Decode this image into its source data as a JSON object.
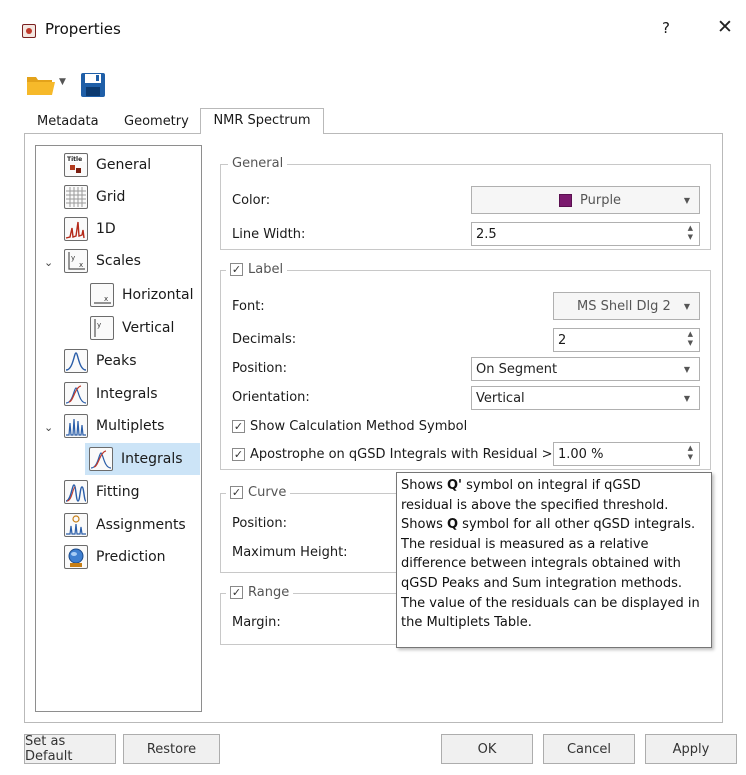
{
  "window": {
    "title": "Properties",
    "help_label": "?",
    "close_label": "✕"
  },
  "toolbar": {
    "open_icon": "folder-icon",
    "save_icon": "save-icon"
  },
  "tabs": [
    {
      "label": "Metadata"
    },
    {
      "label": "Geometry"
    },
    {
      "label": "NMR Spectrum",
      "active": true
    }
  ],
  "tree": {
    "items": [
      {
        "label": "General",
        "icon": "title-icon"
      },
      {
        "label": "Grid",
        "icon": "grid-icon"
      },
      {
        "label": "1D",
        "icon": "spectrum-1d-icon"
      },
      {
        "label": "Scales",
        "icon": "scales-icon",
        "expanded": true
      },
      {
        "label": "Horizontal",
        "icon": "horizontal-scale-icon"
      },
      {
        "label": "Vertical",
        "icon": "vertical-scale-icon"
      },
      {
        "label": "Peaks",
        "icon": "peaks-icon"
      },
      {
        "label": "Integrals",
        "icon": "integrals-icon"
      },
      {
        "label": "Multiplets",
        "icon": "multiplets-icon",
        "expanded": true
      },
      {
        "label": "Integrals",
        "icon": "integrals-icon",
        "selected": true
      },
      {
        "label": "Fitting",
        "icon": "fitting-icon"
      },
      {
        "label": "Assignments",
        "icon": "assignments-icon"
      },
      {
        "label": "Prediction",
        "icon": "prediction-icon"
      }
    ]
  },
  "general": {
    "title": "General",
    "color_label": "Color:",
    "color_value": "Purple",
    "color_swatch": "#7b1a6e",
    "line_width_label": "Line Width:",
    "line_width_value": "2.5"
  },
  "label": {
    "title": "Label",
    "checked": true,
    "font_label": "Font:",
    "font_value": "MS Shell Dlg 2",
    "decimals_label": "Decimals:",
    "decimals_value": "2",
    "position_label": "Position:",
    "position_value": "On Segment",
    "orientation_label": "Orientation:",
    "orientation_value": "Vertical",
    "show_calc_label": "Show Calculation Method Symbol",
    "apostrophe_label": "Apostrophe on qGSD Integrals with Residual >",
    "apostrophe_value": "1.00 %"
  },
  "curve": {
    "title": "Curve",
    "checked": true,
    "position_label": "Position:",
    "max_height_label": "Maximum Height:"
  },
  "range": {
    "title": "Range",
    "checked": true,
    "margin_label": "Margin:"
  },
  "tooltip": {
    "l1a": "Shows ",
    "l1b": "Q'",
    "l1c": " symbol on integral if qGSD",
    "l2": "residual is above the specified threshold.",
    "l3a": "Shows ",
    "l3b": "Q",
    "l3c": " symbol for all other qGSD integrals.",
    "l4": "The residual is measured as a relative",
    "l5": "difference between integrals obtained with",
    "l6": "qGSD Peaks and Sum integration methods.",
    "l7": "The value of the residuals can be displayed in",
    "l8": "the Multiplets Table."
  },
  "buttons": {
    "set_default": "Set as Default",
    "restore": "Restore",
    "ok": "OK",
    "cancel": "Cancel",
    "apply": "Apply"
  }
}
